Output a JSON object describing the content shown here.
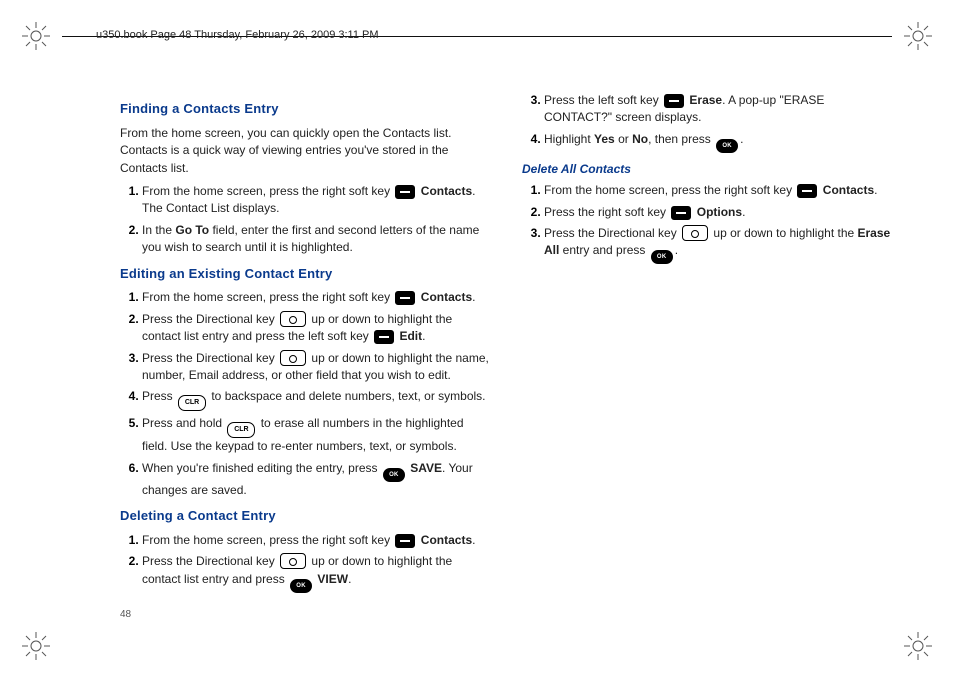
{
  "meta_line": "u350.book  Page 48  Thursday, February 26, 2009  3:11 PM",
  "page_number": "48",
  "h_finding": "Finding a Contacts Entry",
  "p_finding_intro": "From the home screen, you can quickly open the Contacts list. Contacts is a quick way of viewing entries you've stored in the Contacts list.",
  "finding": {
    "s1a": "From the home screen, press the right soft key ",
    "s1b": "Contacts",
    "s1c": ". The Contact List displays.",
    "s2a": "In the ",
    "s2b": "Go To",
    "s2c": " field, enter the first and second letters of the name you wish to search until it is highlighted."
  },
  "h_editing": "Editing an Existing Contact Entry",
  "editing": {
    "s1a": "From the home screen, press the right soft key ",
    "s1b": "Contacts",
    "s1c": ".",
    "s2a": "Press the Directional key ",
    "s2b": " up or down to highlight the contact list entry and press the left soft key ",
    "s2c": "Edit",
    "s2d": ".",
    "s3a": "Press the Directional key ",
    "s3b": " up or down to highlight the name, number, Email address, or other field that you wish to edit.",
    "s4a": "Press ",
    "s4b": " to backspace and delete numbers, text, or symbols.",
    "s5a": "Press and hold ",
    "s5b": " to erase all numbers in the highlighted field. Use the keypad to re-enter numbers, text, or symbols.",
    "s6a": "When you're finished editing the entry, press ",
    "s6b": "SAVE",
    "s6c": ". Your changes are saved."
  },
  "h_deleting": "Deleting a Contact Entry",
  "deleting": {
    "s1a": "From the home screen, press the right soft key ",
    "s1b": "Contacts",
    "s1c": ".",
    "s2a": "Press the Directional key ",
    "s2b": " up or down to highlight the contact list entry and press ",
    "s2c": "VIEW",
    "s2d": ".",
    "s3a": "Press the left soft key ",
    "s3b": "Erase",
    "s3c": ". A pop-up \"ERASE CONTACT?\" screen displays.",
    "s4a": "Highlight ",
    "s4b": "Yes",
    "s4c": " or ",
    "s4d": "No",
    "s4e": ", then press ",
    "s4f": "."
  },
  "h_deleteall": "Delete All Contacts",
  "deleteall": {
    "s1a": "From the home screen, press the right soft key ",
    "s1b": "Contacts",
    "s1c": ".",
    "s2a": "Press the right soft key ",
    "s2b": "Options",
    "s2c": ".",
    "s3a": "Press the Directional key ",
    "s3b": " up or down to highlight the ",
    "s3c": "Erase All",
    "s3d": " entry and press ",
    "s3e": "."
  },
  "clr_label": "CLR",
  "ok_label": "OK"
}
